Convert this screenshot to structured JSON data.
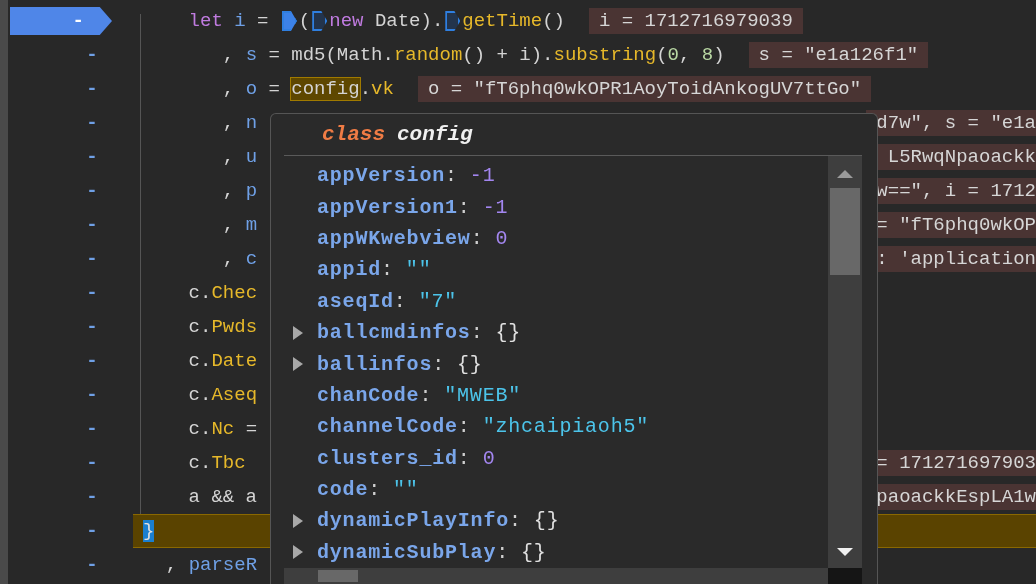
{
  "rows": [
    {
      "gutter": "-",
      "breakpoint": true,
      "current": false,
      "indent": "    ",
      "code": [
        {
          "kind": "keyword",
          "text": "let"
        },
        {
          "kind": "var",
          "text": " i"
        },
        {
          "kind": "plain",
          "text": " = "
        },
        {
          "kind": "marker",
          "active": true
        },
        {
          "kind": "plain",
          "text": "("
        },
        {
          "kind": "marker",
          "active": false
        },
        {
          "kind": "keyword",
          "text": "new"
        },
        {
          "kind": "plain",
          "text": " Date)."
        },
        {
          "kind": "marker",
          "active": false
        },
        {
          "kind": "prop",
          "text": "getTime"
        },
        {
          "kind": "plain",
          "text": "()"
        }
      ],
      "value": "i = 1712716979039"
    },
    {
      "gutter": "-",
      "breakpoint": false,
      "current": false,
      "indent": "       ",
      "code": [
        {
          "kind": "plain",
          "text": ", "
        },
        {
          "kind": "var",
          "text": "s"
        },
        {
          "kind": "plain",
          "text": " = md5(Math."
        },
        {
          "kind": "prop",
          "text": "random"
        },
        {
          "kind": "plain",
          "text": "() + i)."
        },
        {
          "kind": "prop",
          "text": "substring"
        },
        {
          "kind": "plain",
          "text": "("
        },
        {
          "kind": "num",
          "text": "0"
        },
        {
          "kind": "plain",
          "text": ", "
        },
        {
          "kind": "num",
          "text": "8"
        },
        {
          "kind": "plain",
          "text": ")"
        }
      ],
      "value": "s = \"e1a126f1\""
    },
    {
      "gutter": "-",
      "breakpoint": false,
      "current": false,
      "indent": "       ",
      "code": [
        {
          "kind": "plain",
          "text": ", "
        },
        {
          "kind": "var",
          "text": "o"
        },
        {
          "kind": "plain",
          "text": " = "
        },
        {
          "kind": "match",
          "text": "config"
        },
        {
          "kind": "plain",
          "text": "."
        },
        {
          "kind": "prop",
          "text": "vk"
        }
      ],
      "value": "o = \"fT6phq0wkOPR1AoyToidAnkogUV7ttGo\""
    },
    {
      "gutter": "-",
      "breakpoint": false,
      "current": false,
      "indent": "       ",
      "code": [
        {
          "kind": "plain",
          "text": ", "
        },
        {
          "kind": "var",
          "text": "n"
        }
      ],
      "tail": "d7w\", s = \"e1a"
    },
    {
      "gutter": "-",
      "breakpoint": false,
      "current": false,
      "indent": "       ",
      "code": [
        {
          "kind": "plain",
          "text": ", "
        },
        {
          "kind": "var",
          "text": "u"
        }
      ],
      "tail": "L5RwqNpaoackk"
    },
    {
      "gutter": "-",
      "breakpoint": false,
      "current": false,
      "indent": "       ",
      "code": [
        {
          "kind": "plain",
          "text": ", "
        },
        {
          "kind": "var",
          "text": "p"
        }
      ],
      "tail": "w==\", i = 1712"
    },
    {
      "gutter": "-",
      "breakpoint": false,
      "current": false,
      "indent": "       ",
      "code": [
        {
          "kind": "plain",
          "text": ", "
        },
        {
          "kind": "var",
          "text": "m"
        }
      ],
      "tail": "= \"fT6phq0wkOP"
    },
    {
      "gutter": "-",
      "breakpoint": false,
      "current": false,
      "indent": "       ",
      "code": [
        {
          "kind": "plain",
          "text": ", "
        },
        {
          "kind": "var",
          "text": "c"
        }
      ],
      "tail": ": 'application"
    },
    {
      "gutter": "-",
      "breakpoint": false,
      "current": false,
      "indent": "    ",
      "code": [
        {
          "kind": "plain",
          "text": "c."
        },
        {
          "kind": "prop",
          "text": "Chec"
        }
      ]
    },
    {
      "gutter": "-",
      "breakpoint": false,
      "current": false,
      "indent": "    ",
      "code": [
        {
          "kind": "plain",
          "text": "c."
        },
        {
          "kind": "prop",
          "text": "Pwds"
        }
      ]
    },
    {
      "gutter": "-",
      "breakpoint": false,
      "current": false,
      "indent": "    ",
      "code": [
        {
          "kind": "plain",
          "text": "c."
        },
        {
          "kind": "prop",
          "text": "Date"
        }
      ]
    },
    {
      "gutter": "-",
      "breakpoint": false,
      "current": false,
      "indent": "    ",
      "code": [
        {
          "kind": "plain",
          "text": "c."
        },
        {
          "kind": "prop",
          "text": "Aseq"
        }
      ]
    },
    {
      "gutter": "-",
      "breakpoint": false,
      "current": false,
      "indent": "    ",
      "code": [
        {
          "kind": "plain",
          "text": "c."
        },
        {
          "kind": "prop",
          "text": "Nc"
        },
        {
          "kind": "plain",
          "text": " ="
        }
      ]
    },
    {
      "gutter": "-",
      "breakpoint": false,
      "current": false,
      "indent": "    ",
      "code": [
        {
          "kind": "plain",
          "text": "c."
        },
        {
          "kind": "prop",
          "text": "Tbc"
        }
      ],
      "tail": "= 171271697903"
    },
    {
      "gutter": "-",
      "breakpoint": false,
      "current": false,
      "indent": "    ",
      "code": [
        {
          "kind": "plain",
          "text": "a && a"
        }
      ],
      "tail": "paoackkEspLA1w"
    },
    {
      "gutter": "-",
      "breakpoint": false,
      "current": true,
      "indent": "",
      "code": [
        {
          "kind": "cursor",
          "text": "}"
        }
      ]
    },
    {
      "gutter": "-",
      "breakpoint": false,
      "current": false,
      "indent": "  ",
      "code": [
        {
          "kind": "plain",
          "text": ", "
        },
        {
          "kind": "var",
          "text": "parseR"
        }
      ]
    }
  ],
  "popover": {
    "keyword": "class",
    "title": "config",
    "properties": [
      {
        "key": "appVersion",
        "separator": ":",
        "value": "-1",
        "kind": "number",
        "expandable": false
      },
      {
        "key": "appVersion1",
        "separator": ":",
        "value": "-1",
        "kind": "number",
        "expandable": false
      },
      {
        "key": "appWKwebview",
        "separator": ":",
        "value": "0",
        "kind": "number",
        "expandable": false
      },
      {
        "key": "appid",
        "separator": ":",
        "value": "\"\"",
        "kind": "string",
        "expandable": false
      },
      {
        "key": "aseqId",
        "separator": ":",
        "value": "\"7\"",
        "kind": "string",
        "expandable": false
      },
      {
        "key": "ballcmdinfos",
        "separator": ":",
        "value": "{}",
        "kind": "object",
        "expandable": true
      },
      {
        "key": "ballinfos",
        "separator": ":",
        "value": "{}",
        "kind": "object",
        "expandable": true
      },
      {
        "key": "chanCode",
        "separator": ":",
        "value": "\"MWEB\"",
        "kind": "string",
        "expandable": false
      },
      {
        "key": "channelCode",
        "separator": ":",
        "value": "\"zhcaipiaoh5\"",
        "kind": "string",
        "expandable": false
      },
      {
        "key": "clusters_id",
        "separator": ":",
        "value": "0",
        "kind": "number",
        "expandable": false
      },
      {
        "key": "code",
        "separator": ":",
        "value": "\"\"",
        "kind": "string",
        "expandable": false
      },
      {
        "key": "dynamicPlayInfo",
        "separator": ":",
        "value": "{}",
        "kind": "object",
        "expandable": true
      },
      {
        "key": "dynamicSubPlay",
        "separator": ":",
        "value": "{}",
        "kind": "object",
        "expandable": true
      }
    ]
  }
}
